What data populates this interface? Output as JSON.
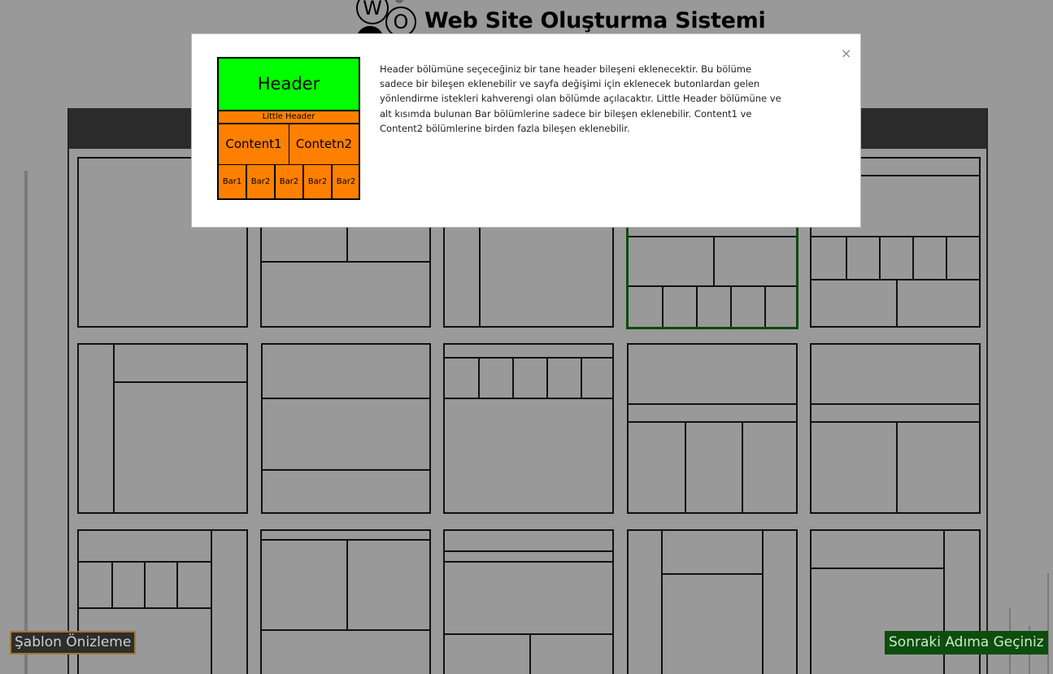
{
  "header": {
    "logo_letters": [
      "W",
      "O"
    ],
    "title": "Web Site Oluşturma Sistemi"
  },
  "templates": {
    "selected_index": 3
  },
  "buttons": {
    "preview": "Şablon Önizleme",
    "next": "Sonraki Adıma Geçiniz"
  },
  "modal": {
    "close_label": "×",
    "diagram": {
      "header": "Header",
      "little_header": "Little Header",
      "content1": "Content1",
      "content2": "Contetn2",
      "bars": [
        "Bar1",
        "Bar2",
        "Bar2",
        "Bar2",
        "Bar2"
      ]
    },
    "description": "Header bölümüne seçeceğiniz bir tane header bileşeni eklenecektir. Bu bölüme sadece bir bileşen eklenebilir ve sayfa değişimi için eklenecek butonlardan gelen yönlendirme istekleri kahverengi olan bölümde açılacaktır. Little Header bölümüne ve alt kısımda bulunan Bar bölümlerine sadece bir bileşen eklenebilir. Content1 ve Content2 bölümlerine birden fazla bileşen eklenebilir."
  },
  "colors": {
    "background": "#999999",
    "header_block": "#00ff00",
    "content_block": "#ff8000",
    "next_button": "#0d4d0d",
    "selected_border": "#0a4a0a"
  }
}
